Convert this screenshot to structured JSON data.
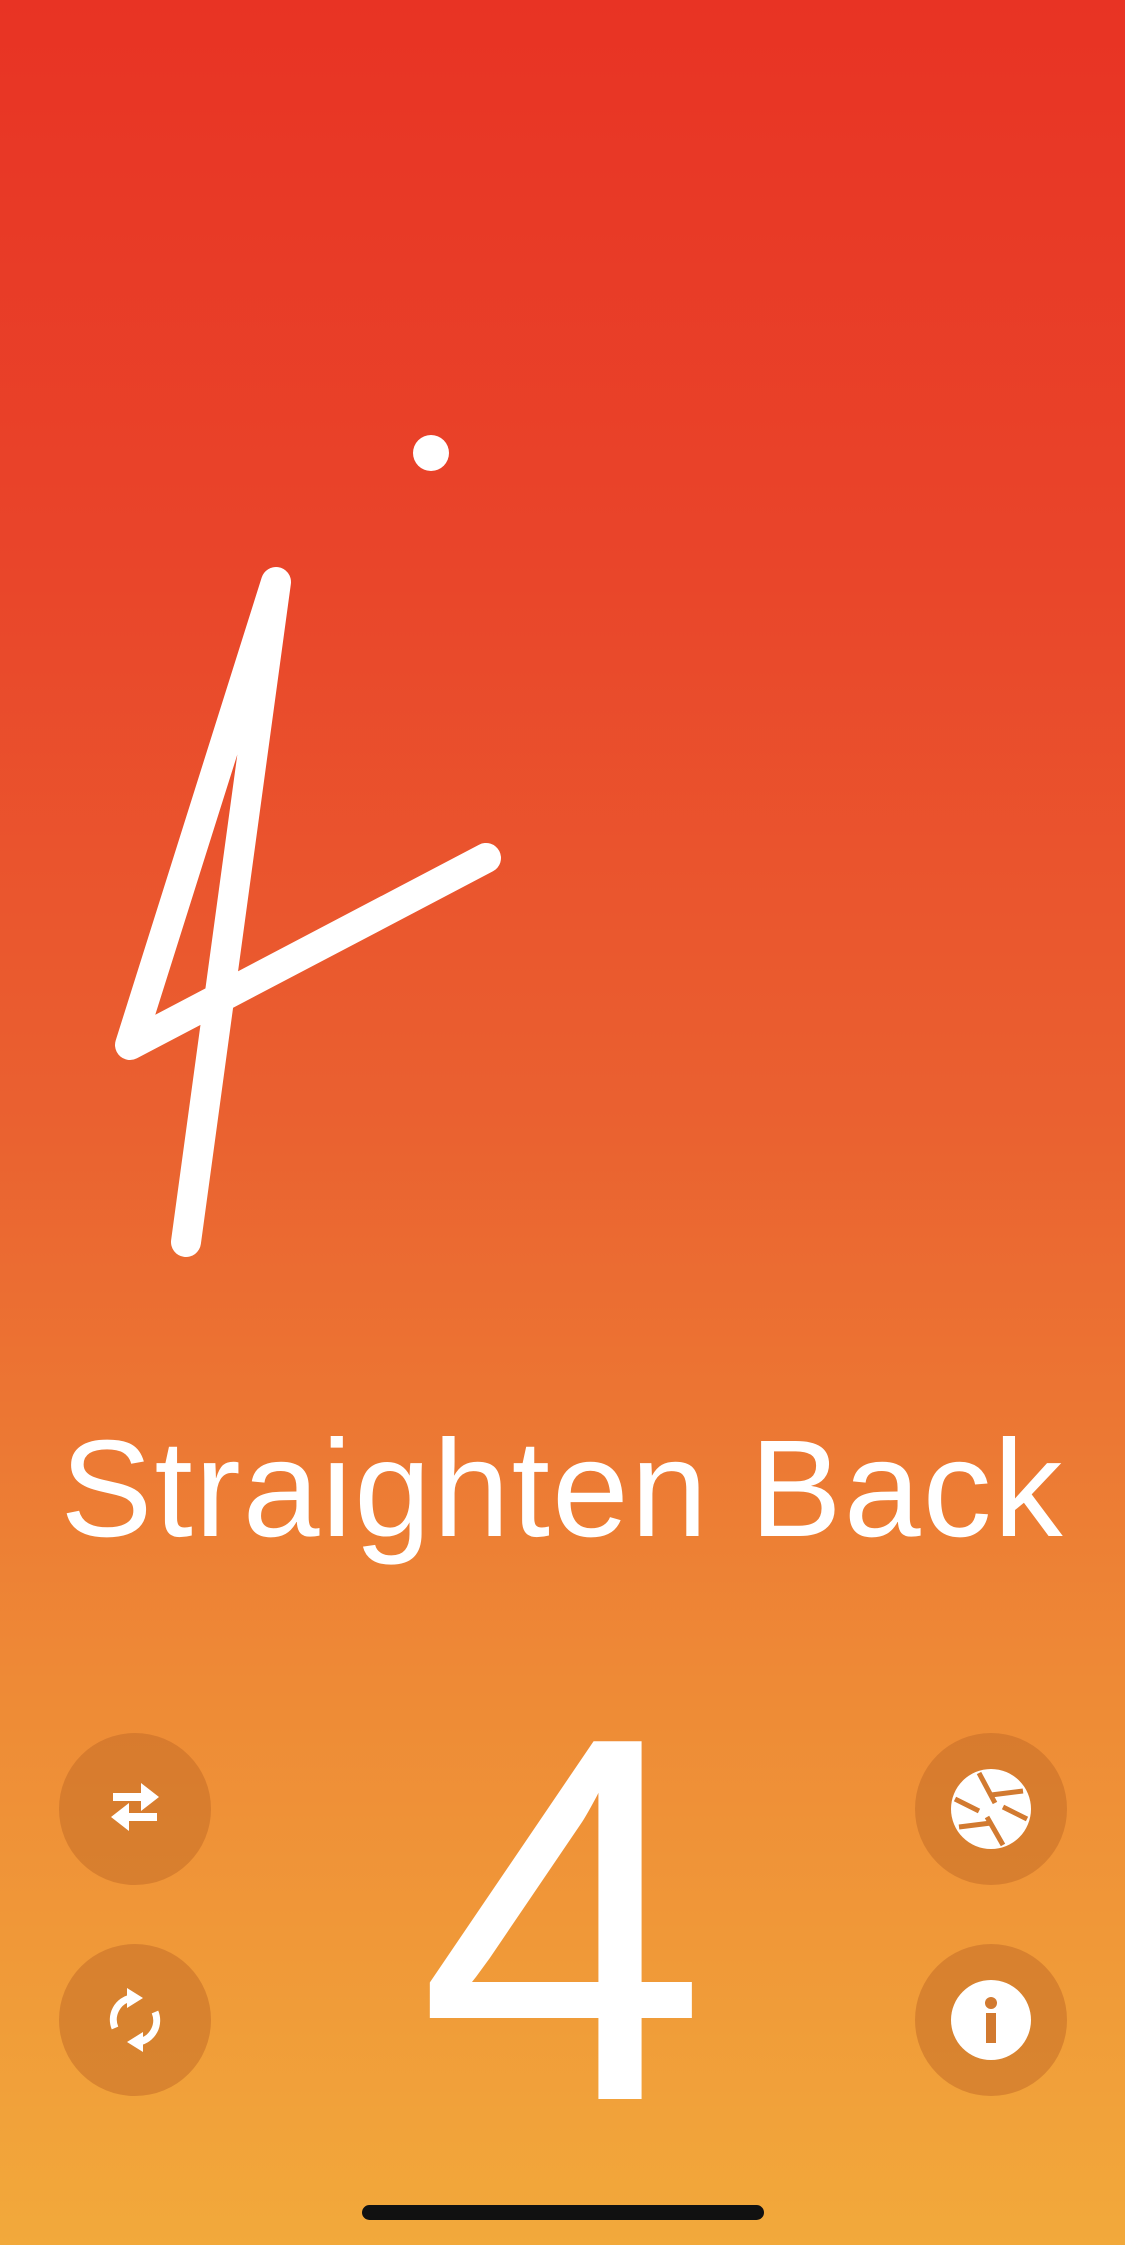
{
  "exercise": {
    "title": "Straighten Back",
    "count": "4"
  },
  "controls": {
    "swap": "swap-arrows-icon",
    "refresh": "refresh-icon",
    "shutter": "camera-aperture-icon",
    "info": "info-icon"
  },
  "colors": {
    "gradient_top": "#E83324",
    "gradient_bottom": "#F2A93B",
    "button_fill": "#C46E28",
    "foreground": "#FFFFFF"
  }
}
